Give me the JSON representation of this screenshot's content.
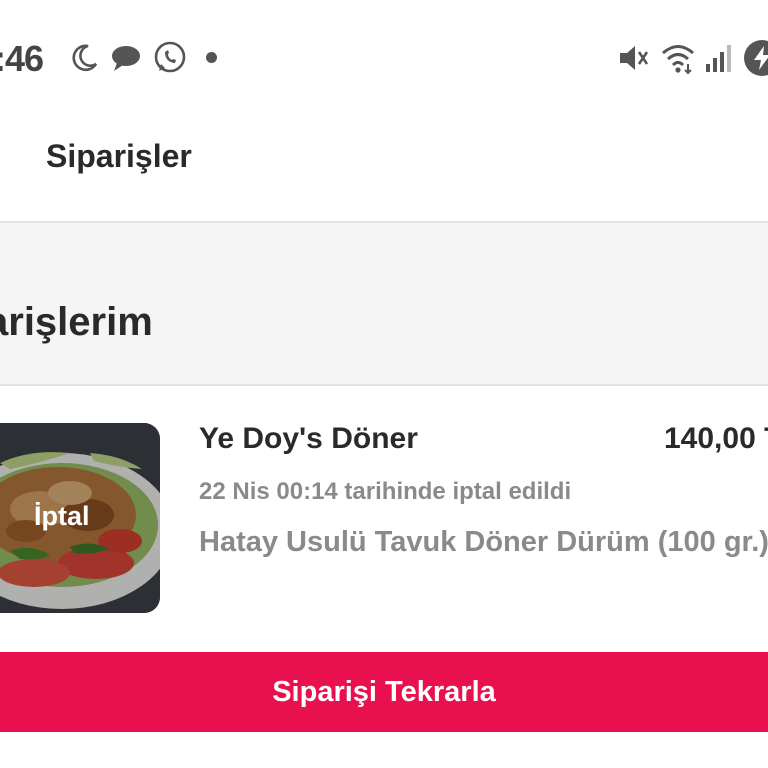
{
  "status_bar": {
    "time": ":46",
    "icons": [
      "moon-icon",
      "chat-icon",
      "whatsapp-icon",
      "notification-dot",
      "mute-icon",
      "wifi-icon",
      "signal-icon",
      "battery-icon"
    ]
  },
  "header": {
    "title": "Siparişler"
  },
  "section": {
    "title": "arişlerim"
  },
  "order": {
    "restaurant": "Ye Doy's Döner",
    "price": "140,00 T",
    "status_text": "22 Nis 00:14 tarihinde iptal edildi",
    "item": "Hatay Usulü Tavuk Döner Dürüm (100 gr.)",
    "image_overlay": "İptal"
  },
  "actions": {
    "reorder_label": "Siparişi Tekrarla"
  },
  "colors": {
    "accent": "#e8104e",
    "muted_text": "#8a8a8a",
    "section_bg": "#f5f5f5"
  }
}
